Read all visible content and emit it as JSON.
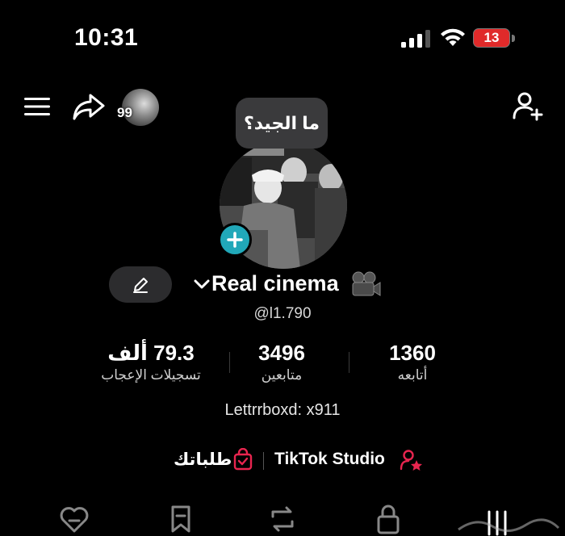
{
  "status_bar": {
    "time": "10:31",
    "battery_level": "13",
    "battery_color": "#e02a2a"
  },
  "header": {
    "story_views": "99"
  },
  "profile": {
    "bubble_text": "ما الجيد؟",
    "display_name": "Real cinema",
    "username": "@l1.790",
    "bio": "Lettrrboxd: x911",
    "add_color": "#21a8b9"
  },
  "stats": [
    {
      "value": "79.3 ألف",
      "label": "تسجيلات الإعجاب"
    },
    {
      "value": "3496",
      "label": "متابعين"
    },
    {
      "value": "1360",
      "label": "أتابعه"
    }
  ],
  "links": {
    "studio": "TikTok Studio",
    "orders": "طلباتك",
    "accent": "#e8254f"
  },
  "tabs": [
    "liked-heart-icon",
    "favorites-icon",
    "reposts-icon",
    "private-lock-icon",
    "videos-grid-icon"
  ]
}
